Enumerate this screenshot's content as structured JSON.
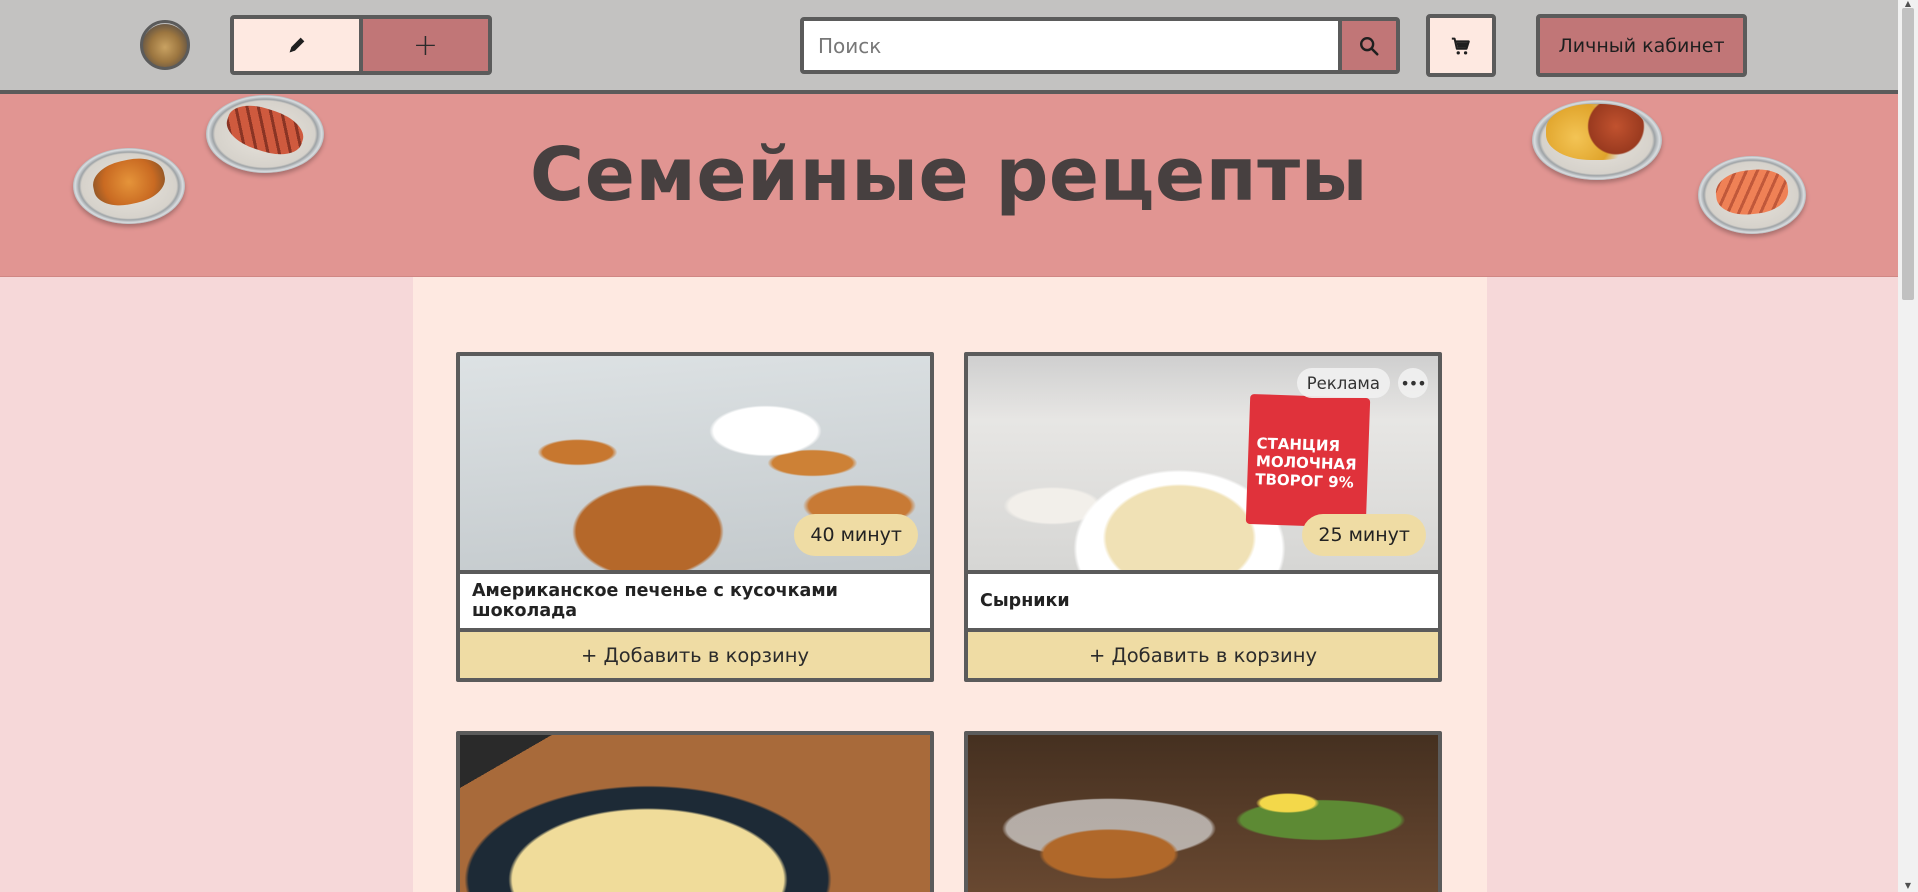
{
  "header": {
    "avatar_icon": "hedgehog-avatar-icon",
    "edit_icon": "pen-icon",
    "add_label": "+",
    "search": {
      "placeholder": "Поиск",
      "value": "",
      "icon": "search-icon"
    },
    "cart_icon": "cart-icon",
    "account_label": "Личный кабинет"
  },
  "banner": {
    "title": "Семейные рецепты",
    "decorations": [
      "fish-plate-icon",
      "grilled-fish-plate-icon",
      "sausages-pasta-plate-icon",
      "salmon-plate-icon"
    ]
  },
  "recipes": [
    {
      "name": "Американское печенье с кусочками шоколада",
      "time": "40 минут",
      "add_label": "+ Добавить в корзину",
      "ad": false
    },
    {
      "name": "Сырники",
      "time": "25 минут",
      "add_label": "+ Добавить в корзину",
      "ad": true,
      "ad_label": "Реклама",
      "ad_more": "•••",
      "pack_text": "СТАНЦИЯ\nМОЛОЧНАЯ\nТВОРОГ 9%"
    },
    {
      "name": "",
      "time": "",
      "add_label": "",
      "ad": false
    },
    {
      "name": "",
      "time": "",
      "add_label": "",
      "ad": false
    }
  ],
  "colors": {
    "topbar": "#c3c2c1",
    "banner": "#e19592",
    "page_bg": "#f6d8d9",
    "content_bg": "#fee9e1",
    "accent": "#c17677",
    "badge": "#efdca4",
    "border": "#5b5b5b"
  }
}
